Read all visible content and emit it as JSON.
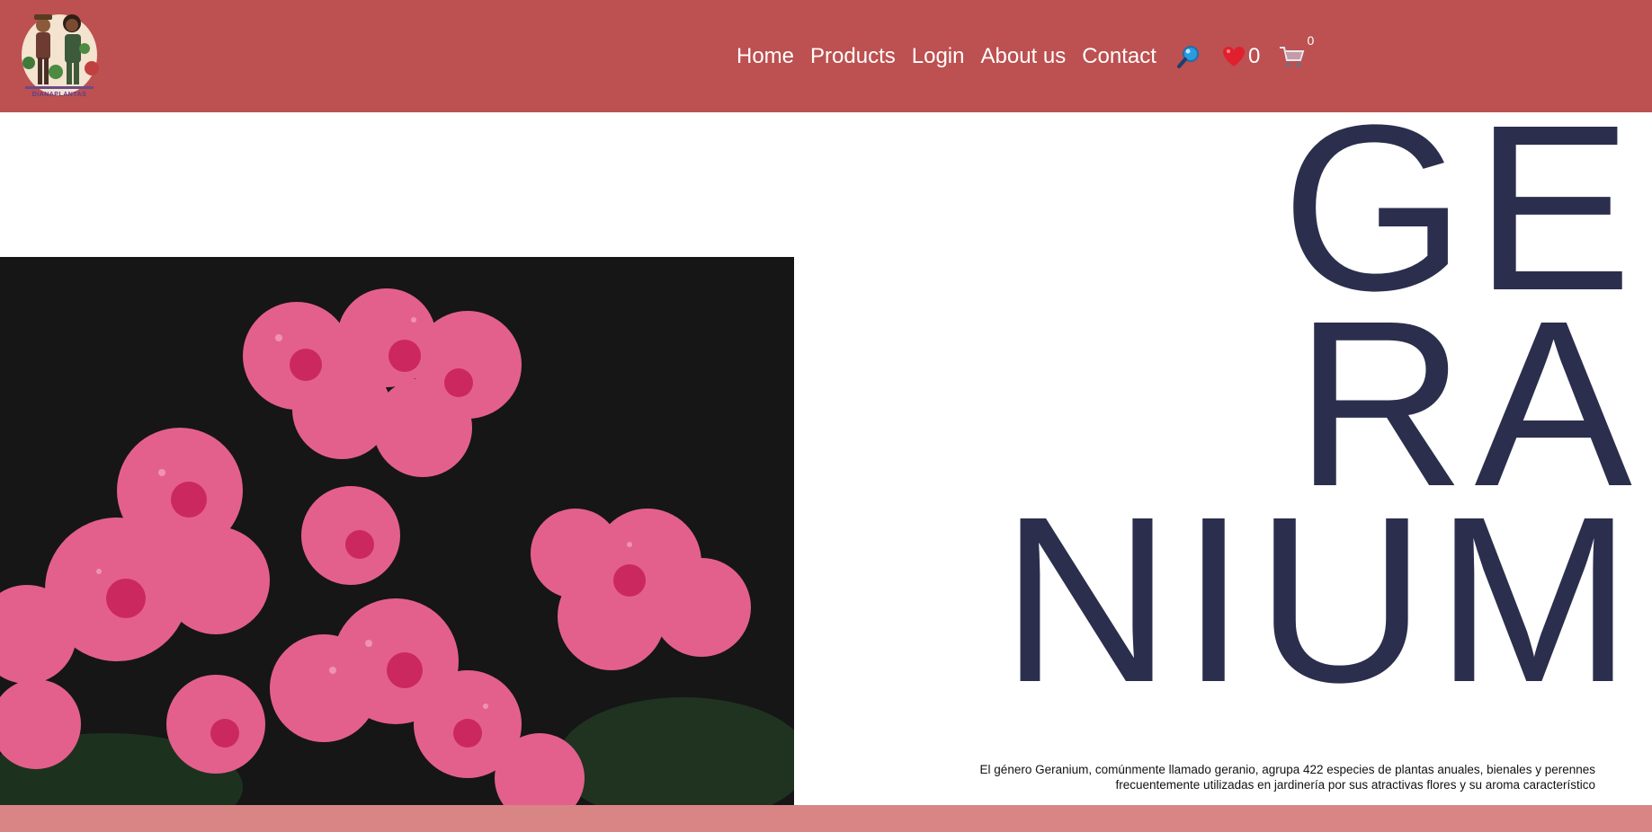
{
  "header": {
    "logo_text": "DIANAPLANTAS",
    "nav": [
      {
        "label": "Home"
      },
      {
        "label": "Products"
      },
      {
        "label": "Login"
      },
      {
        "label": "About us"
      },
      {
        "label": "Contact"
      }
    ],
    "search_icon": "search-icon",
    "wishlist_icon": "heart-icon",
    "wishlist_count": "0",
    "cart_icon": "cart-icon",
    "cart_count": "0"
  },
  "hero": {
    "title_lines": [
      "GE",
      "RA",
      "NIUM"
    ],
    "description_line1": "El género Geranium, comúnmente llamado geranio, agrupa 422 especies de plantas anuales, bienales y perennes",
    "description_line2": "frecuentemente utilizadas en jardinería por sus atractivas flores y su aroma característico",
    "image_subject": "pink geranium flowers with water droplets"
  },
  "colors": {
    "header_bg": "#bd5050",
    "footer_bg": "#d98585",
    "title_color": "#2b2f4d",
    "image_bg": "#161616"
  }
}
